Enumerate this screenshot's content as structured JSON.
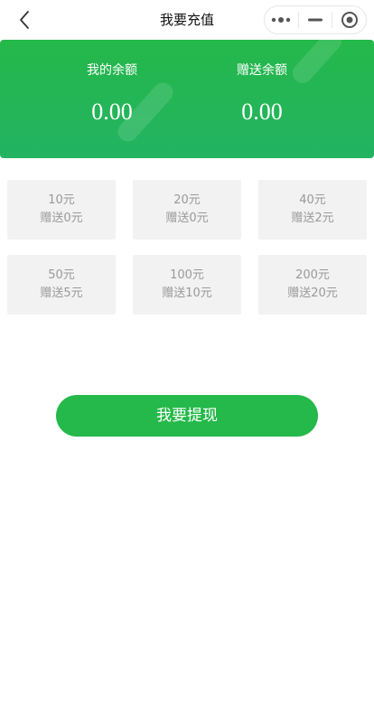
{
  "nav": {
    "title": "我要充值"
  },
  "balance": {
    "my_label": "我的余额",
    "my_amount": "0.00",
    "gift_label": "赠送余额",
    "gift_amount": "0.00"
  },
  "options": [
    {
      "amount": "10元",
      "gift": "赠送0元"
    },
    {
      "amount": "20元",
      "gift": "赠送0元"
    },
    {
      "amount": "40元",
      "gift": "赠送2元"
    },
    {
      "amount": "50元",
      "gift": "赠送5元"
    },
    {
      "amount": "100元",
      "gift": "赠送10元"
    },
    {
      "amount": "200元",
      "gift": "赠送20元"
    }
  ],
  "actions": {
    "withdraw_label": "我要提现"
  },
  "colors": {
    "brand_green": "#25b84a",
    "option_bg": "#f2f2f2",
    "option_text": "#999999"
  },
  "icons": {
    "back": "chevron-left-icon",
    "more": "more-dots-icon",
    "minimize": "minimize-icon",
    "close": "target-close-icon"
  }
}
